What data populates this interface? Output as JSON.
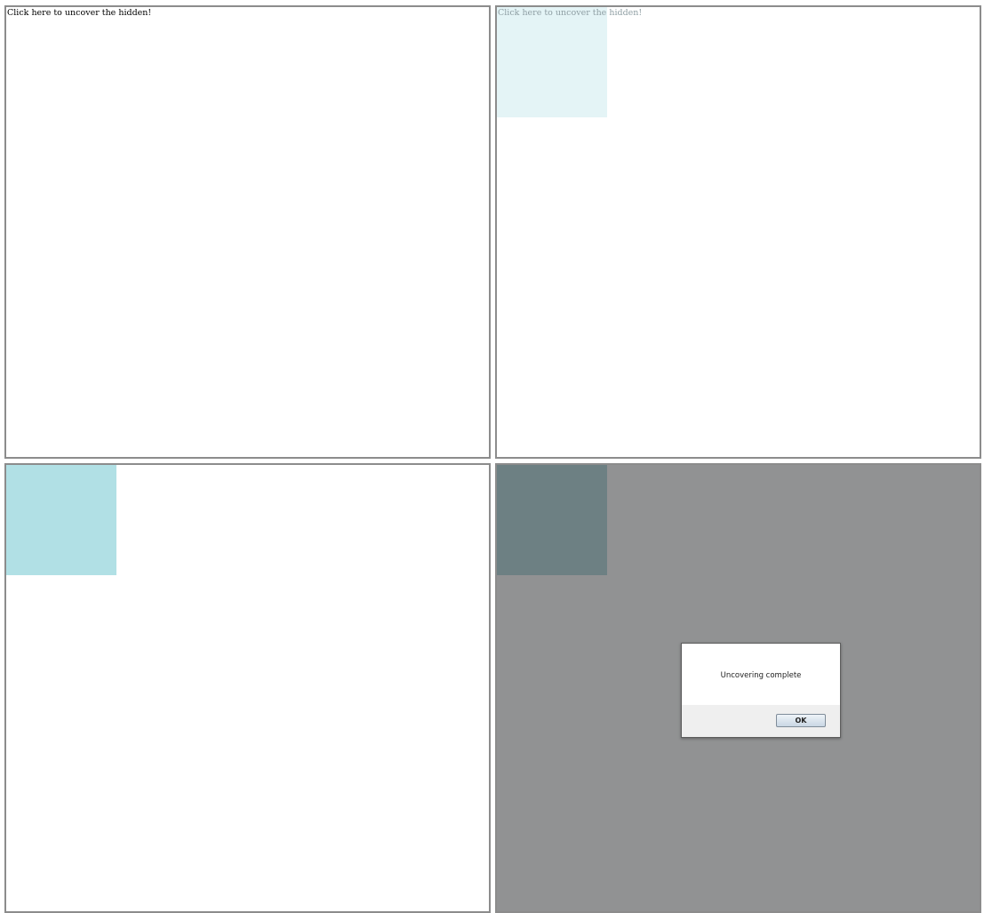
{
  "frames": [
    {
      "id": "frame-1",
      "link_text": "Click here to uncover the hidden!"
    },
    {
      "id": "frame-2",
      "link_text": "Click here to uncover the hidden!"
    },
    {
      "id": "frame-3"
    },
    {
      "id": "frame-4",
      "dialog": {
        "message": "Uncovering complete",
        "ok_label": "OK"
      }
    }
  ],
  "colors": {
    "link_normal": "#000000",
    "link_faded": "#8e9ea3",
    "square_light": "#e4f4f6",
    "square_mid": "#b1e0e5",
    "square_dimmed": "#6d8083",
    "overlay": "#919293",
    "frame_border": "#8c8c8c"
  }
}
